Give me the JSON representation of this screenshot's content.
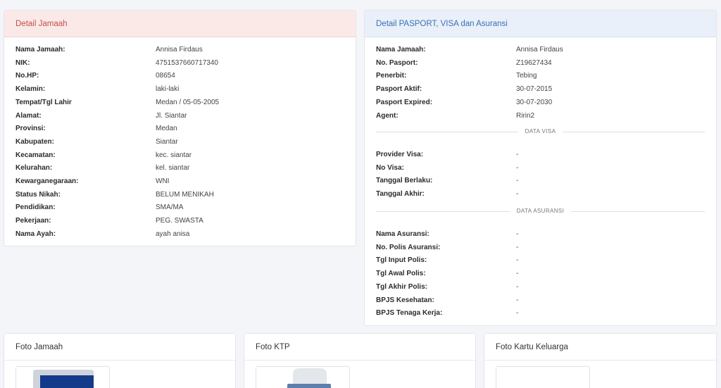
{
  "jamaah": {
    "title": "Detail Jamaah",
    "rows": [
      {
        "label": "Nama Jamaah:",
        "value": "Annisa Firdaus"
      },
      {
        "label": "NIK:",
        "value": "4751537660717340"
      },
      {
        "label": "No.HP:",
        "value": "08654"
      },
      {
        "label": "Kelamin:",
        "value": "laki-laki"
      },
      {
        "label": "Tempat/Tgl Lahir",
        "value": "Medan / 05-05-2005"
      },
      {
        "label": "Alamat:",
        "value": "Jl. Siantar"
      },
      {
        "label": "Provinsi:",
        "value": "Medan"
      },
      {
        "label": "Kabupaten:",
        "value": "Siantar"
      },
      {
        "label": "Kecamatan:",
        "value": "kec. siantar"
      },
      {
        "label": "Kelurahan:",
        "value": "kel. siantar"
      },
      {
        "label": "Kewarganegaraan:",
        "value": "WNI"
      },
      {
        "label": "Status Nikah:",
        "value": "BELUM MENIKAH"
      },
      {
        "label": "Pendidikan:",
        "value": "SMA/MA"
      },
      {
        "label": "Pekerjaan:",
        "value": "PEG. SWASTA"
      },
      {
        "label": "Nama Ayah:",
        "value": "ayah anisa"
      }
    ]
  },
  "paspor": {
    "title": "Detail PASPORT, VISA dan Asuransi",
    "rows": [
      {
        "label": "Nama Jamaah:",
        "value": "Annisa Firdaus"
      },
      {
        "label": "No. Pasport:",
        "value": "Z19627434"
      },
      {
        "label": "Penerbit:",
        "value": "Tebing"
      },
      {
        "label": "Pasport Aktif:",
        "value": "30-07-2015"
      },
      {
        "label": "Pasport Expired:",
        "value": "30-07-2030"
      },
      {
        "label": "Agent:",
        "value": "Ririn2"
      }
    ],
    "visa_title": "DATA VISA",
    "visa_rows": [
      {
        "label": "Provider Visa:",
        "value": "-"
      },
      {
        "label": "No Visa:",
        "value": "-"
      },
      {
        "label": "Tanggal Berlaku:",
        "value": "-"
      },
      {
        "label": "Tanggal Akhir:",
        "value": "-"
      }
    ],
    "asuransi_title": "DATA ASURANSI",
    "asuransi_rows": [
      {
        "label": "Nama Asuransi:",
        "value": "-"
      },
      {
        "label": "No. Polis Asuransi:",
        "value": "-"
      },
      {
        "label": "Tgl Input Polis:",
        "value": "-"
      },
      {
        "label": "Tgl Awal Polis:",
        "value": "-"
      },
      {
        "label": "Tgl Akhir Polis:",
        "value": "-"
      },
      {
        "label": "BPJS Kesehatan:",
        "value": "-"
      },
      {
        "label": "BPJS Tenaga Kerja:",
        "value": "-"
      }
    ]
  },
  "photos": {
    "foto_jamaah": "Foto Jamaah",
    "foto_ktp": "Foto KTP",
    "foto_kk": "Foto Kartu Keluarga"
  },
  "colors": {
    "red_header": "#fbe9e8",
    "red_text": "#c0504d",
    "blue_header": "#e9f0fa",
    "blue_text": "#3a6fb4"
  }
}
